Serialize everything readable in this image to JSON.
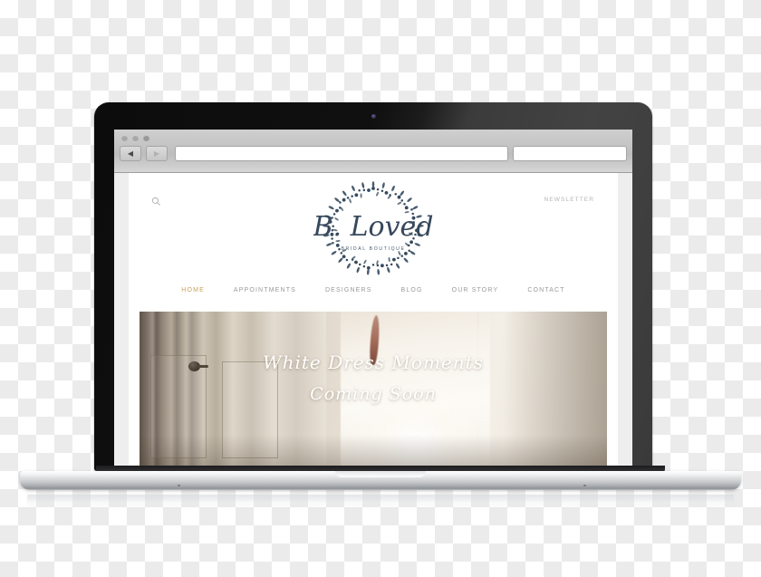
{
  "browser": {
    "window_dots": [
      "dot-1",
      "dot-2",
      "dot-3"
    ],
    "back_label": "◀",
    "forward_label": "▶",
    "url_value": "",
    "url_placeholder": "",
    "search_value": "",
    "search_placeholder": ""
  },
  "site": {
    "search_icon": "search-icon",
    "newsletter_label": "NEWSLETTER",
    "logo": {
      "brand": "B. Loved",
      "tagline": "BRIDAL BOUTIQUE",
      "mark": "laurel-wreath",
      "color": "#364a5e"
    },
    "nav": {
      "active_color": "#c9a15f",
      "idle_color": "#9a9a9a",
      "items": [
        {
          "label": "HOME",
          "active": true
        },
        {
          "label": "APPOINTMENTS",
          "active": false
        },
        {
          "label": "DESIGNERS",
          "active": false
        },
        {
          "label": "BLOG",
          "active": false
        },
        {
          "label": "OUR STORY",
          "active": false
        },
        {
          "label": "CONTACT",
          "active": false
        }
      ]
    },
    "hero": {
      "line1": "White Dress Moments",
      "line2": "Coming Soon",
      "image_alt": "wedding-dress-hanging-on-door"
    }
  },
  "device": {
    "type": "laptop-mockup",
    "bezel_color": "#151515",
    "base_color": "#d2d4d7"
  },
  "canvas": {
    "background": "transparency-checkerboard"
  }
}
